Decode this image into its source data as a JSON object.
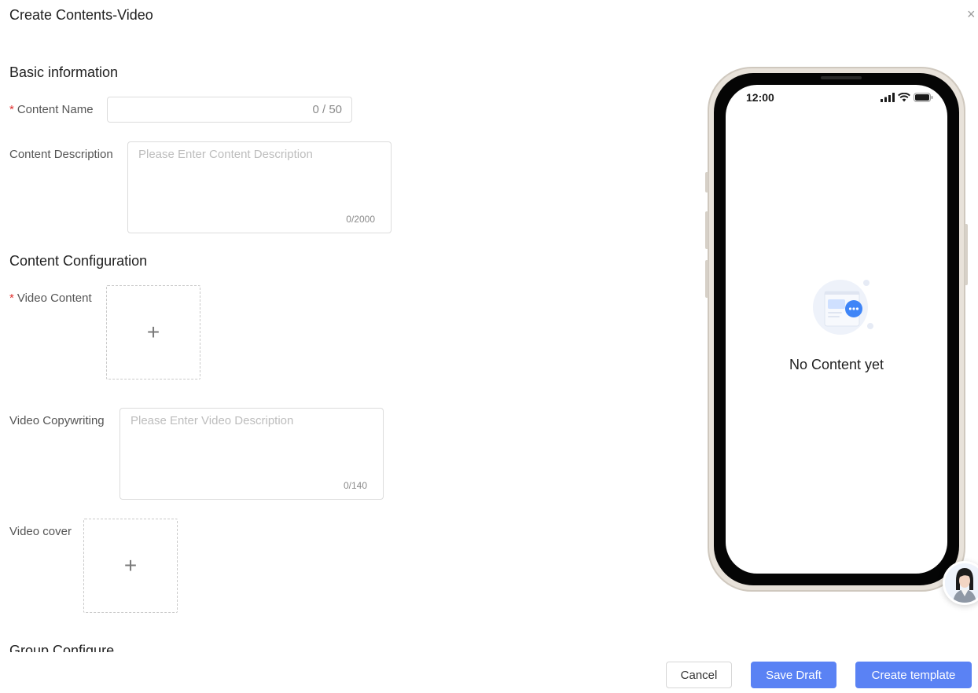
{
  "dialog": {
    "title": "Create Contents-Video",
    "close_glyph": "×"
  },
  "sections": {
    "basic": "Basic information",
    "config": "Content Configuration",
    "group": "Group Configure"
  },
  "form": {
    "required_mark": "*",
    "content_name": {
      "label": "Content Name",
      "value": "",
      "counter": "0 / 50"
    },
    "content_description": {
      "label": "Content Description",
      "placeholder": "Please Enter Content Description",
      "counter": "0/2000"
    },
    "video_content": {
      "label": "Video Content"
    },
    "video_copywriting": {
      "label": "Video Copywriting",
      "placeholder": "Please Enter Video Description",
      "counter": "0/140"
    },
    "video_cover": {
      "label": "Video cover"
    },
    "plus_glyph": "+"
  },
  "preview": {
    "status_time": "12:00",
    "empty_text": "No Content yet"
  },
  "footer": {
    "cancel": "Cancel",
    "save_draft": "Save Draft",
    "create_template": "Create template"
  },
  "colors": {
    "primary": "#5a82f4",
    "required": "#e0302e",
    "border": "#dcdcdc"
  },
  "icons": [
    "close-icon",
    "plus-icon",
    "signal-icon",
    "wifi-icon",
    "battery-icon",
    "empty-content-icon",
    "assistant-avatar-icon"
  ]
}
